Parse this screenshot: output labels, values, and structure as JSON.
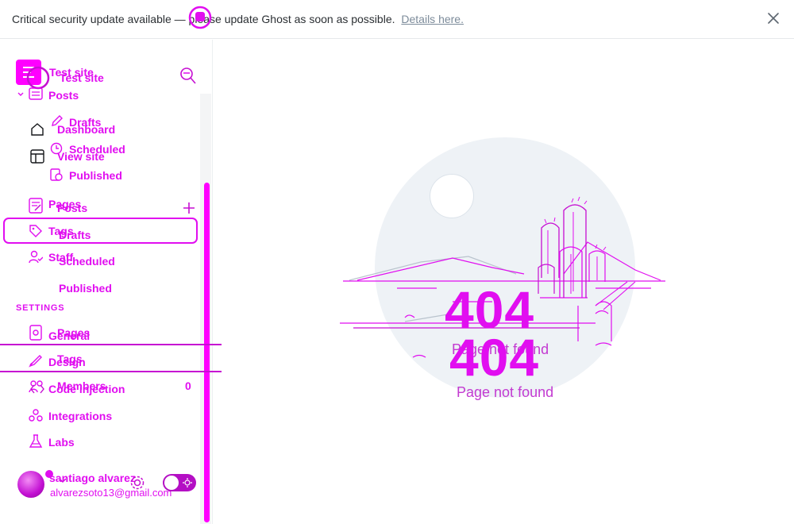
{
  "alert": {
    "message": "Critical security update available — please update Ghost as soon as possible.",
    "link_text": "Details here."
  },
  "site": {
    "title": "Test site"
  },
  "nav": {
    "dashboard": "Dashboard",
    "view_site": "View site",
    "posts": "Posts",
    "drafts": "Drafts",
    "scheduled": "Scheduled",
    "published": "Published",
    "pages": "Pages",
    "tags": "Tags",
    "members": "Members",
    "members_count": "0",
    "staff": "Staff"
  },
  "overlay_nav": {
    "posts": "Posts",
    "drafts": "Drafts",
    "scheduled": "Scheduled",
    "published": "Published",
    "pages": "Pages",
    "tags": "Tags",
    "staff": "Staff"
  },
  "settings": {
    "heading": "SETTINGS",
    "general": "General",
    "design": "Design",
    "code_injection": "Code injection",
    "integrations": "Integrations",
    "labs": "Labs"
  },
  "user": {
    "name": "santiago alvarez",
    "email": "alvarezsoto13@gmail.com"
  },
  "error": {
    "code": "404",
    "message": "Page not found"
  },
  "icons": [
    "ghost-logo-icon",
    "search-icon",
    "home-icon",
    "view-site-icon",
    "posts-icon",
    "pencil-icon",
    "clock-icon",
    "published-icon",
    "pages-icon",
    "plus-icon",
    "tag-icon",
    "staff-icon",
    "members-icon",
    "settings-gear-icon",
    "design-brush-icon",
    "code-icon",
    "integrations-icon",
    "labs-flask-icon",
    "moon-icon",
    "close-icon"
  ],
  "colors": {
    "accent": "#e10ef0",
    "alert_link": "#7c8b9a",
    "illustration_bg": "#eef2f6"
  }
}
